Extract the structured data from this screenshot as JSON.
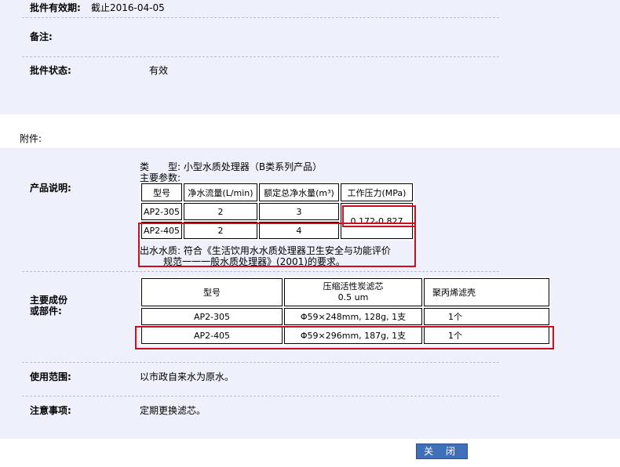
{
  "top": {
    "validity_label": "批件有效期:",
    "validity_value": "截止2016-04-05",
    "remark_label": "备注:",
    "status_label": "批件状态:",
    "status_value": "有效"
  },
  "attachment_label": "附件:",
  "product": {
    "label": "产品说明:",
    "type_line": "类　　型: 小型水质处理器（B类系列产品）",
    "params_title": "主要参数:",
    "headers": [
      "型号",
      "净水流量(L/min)",
      "额定总净水量(m³)",
      "工作压力(MPa)"
    ],
    "rows": [
      [
        "AP2-305",
        "2",
        "3"
      ],
      [
        "AP2-405",
        "2",
        "4"
      ]
    ],
    "pressure": "0.172-0.827",
    "water_quality_line1": "出水水质: 符合《生活饮用水水质处理器卫生安全与功能评价",
    "water_quality_line2": "规范一一一般水质处理器》(2001)的要求。"
  },
  "components": {
    "label_line1": "主要成份",
    "label_line2": "或部件:",
    "headers": [
      "型号",
      "压缩活性炭滤芯",
      "0.5 um",
      "聚丙烯滤壳"
    ],
    "rows": [
      [
        "AP2-305",
        "Φ59×248mm, 128g, 1支",
        "1个"
      ],
      [
        "AP2-405",
        "Φ59×296mm, 187g, 1支",
        "1个"
      ]
    ]
  },
  "scope": {
    "label": "使用范围:",
    "value": "以市政自来水为原水。"
  },
  "notes": {
    "label": "注意事项:",
    "value": "定期更换滤芯。"
  },
  "close_button": "关 闭"
}
